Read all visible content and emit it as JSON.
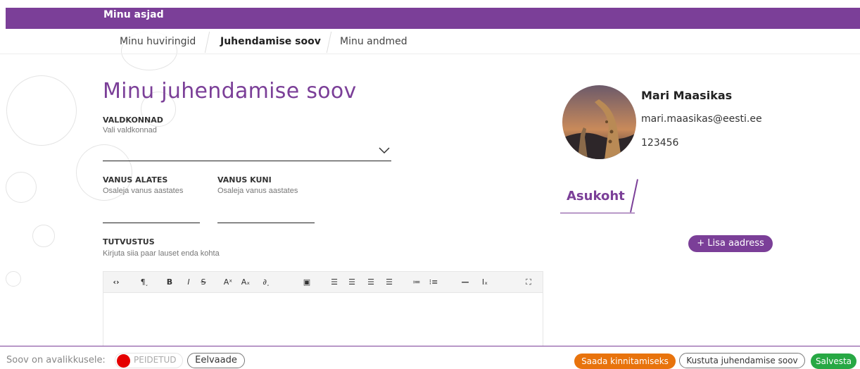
{
  "header": {
    "title": "Minu asjad"
  },
  "tabs": [
    {
      "label": "Minu huviringid",
      "active": false
    },
    {
      "label": "Juhendamise soov",
      "active": true
    },
    {
      "label": "Minu andmed",
      "active": false
    }
  ],
  "form": {
    "heading": "Minu juhendamise soov",
    "fields": {
      "valdkonnad": {
        "label": "VALDKONNAD",
        "hint": "Vali valdkonnad",
        "value": ""
      },
      "vanus_alates": {
        "label": "VANUS ALATES",
        "hint": "Osaleja vanus aastates",
        "value": ""
      },
      "vanus_kuni": {
        "label": "VANUS KUNI",
        "hint": "Osaleja vanus aastates",
        "value": ""
      },
      "tutvustus": {
        "label": "TUTVUSTUS",
        "hint": "Kirjuta siia paar lauset enda kohta",
        "value": ""
      }
    },
    "toolbar": {
      "buttons": [
        "source-code-icon",
        "paragraph-icon",
        "bold-icon",
        "italic-icon",
        "strikethrough-icon",
        "superscript-icon",
        "subscript-icon",
        "link-icon",
        "image-icon",
        "align-left-icon",
        "align-center-icon",
        "align-right-icon",
        "justify-icon",
        "bullet-list-icon",
        "numbered-list-icon",
        "horizontal-rule-icon",
        "clear-format-icon",
        "fullscreen-icon"
      ]
    }
  },
  "profile": {
    "name": "Mari Maasikas",
    "email": "mari.maasikas@eesti.ee",
    "phone": "123456"
  },
  "location": {
    "title": "Asukoht",
    "add_button": "+ Lisa aadress"
  },
  "footer": {
    "public_label": "Soov on avalikkusele:",
    "toggle_label": "PEIDETUD",
    "preview_button": "Eelvaade",
    "send_button": "Saada kinnitamiseks",
    "delete_button": "Kustuta juhendamise soov",
    "save_button": "Salvesta"
  },
  "colors": {
    "brand": "#7b3f98",
    "hidden_indicator": "#e50000",
    "send": "#e8730c",
    "save": "#27a844"
  }
}
